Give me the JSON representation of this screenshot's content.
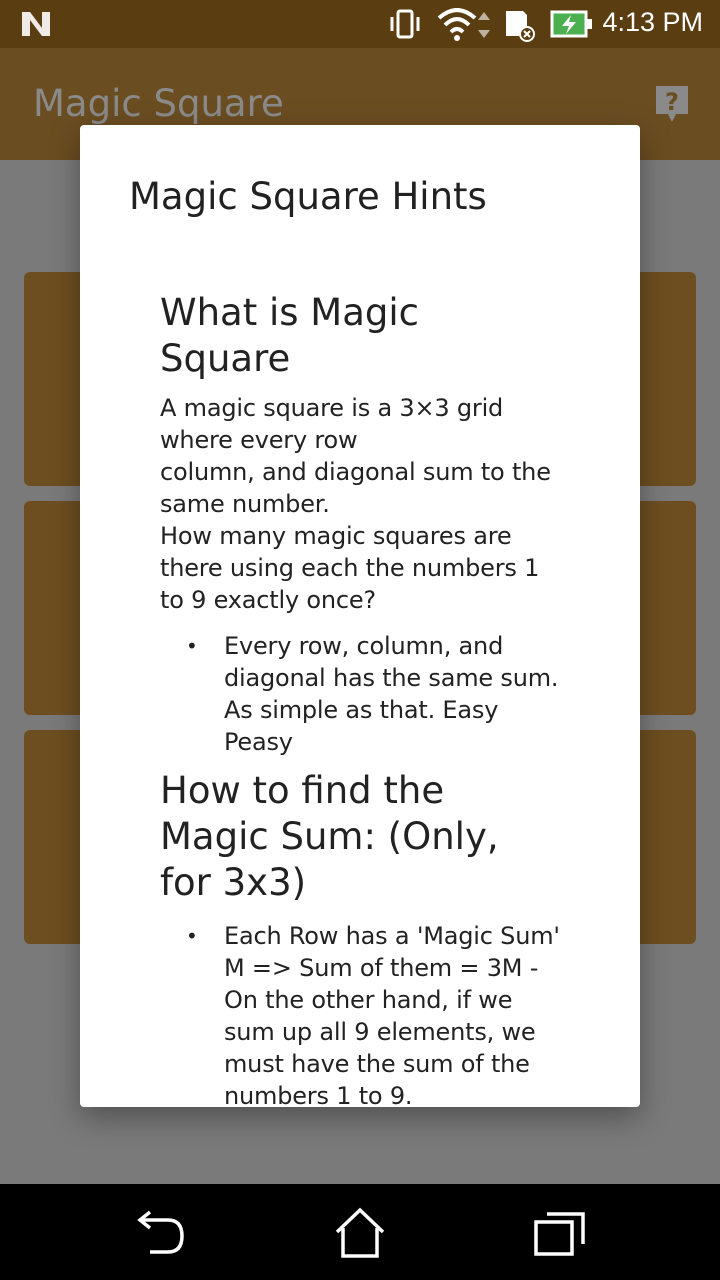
{
  "status_bar": {
    "time": "4:13 PM"
  },
  "app_bar": {
    "title": "Magic Square",
    "help_icon": "help-question-icon"
  },
  "dialog": {
    "title": "Magic Square Hints",
    "sections": [
      {
        "heading": "What is Magic Square",
        "paragraph": " A magic square is a 3×3 grid where every row\n column, and diagonal sum to the same number.\n How many magic squares are there using each the numbers 1 to 9 exactly once?",
        "bullets": [
          "Every row, column, and diagonal has the same sum. As simple as that. Easy Peasy"
        ]
      },
      {
        "heading": "How to find the Magic Sum: (Only, for 3x3)",
        "bullets": [
          "Each Row has a 'Magic Sum' M => Sum of them = 3M - On the other hand, if we sum up all 9 elements, we must have the sum of the numbers 1 to 9."
        ]
      }
    ]
  },
  "nav_bar": {
    "back_icon": "back-icon",
    "home_icon": "home-icon",
    "recents_icon": "recents-icon"
  }
}
